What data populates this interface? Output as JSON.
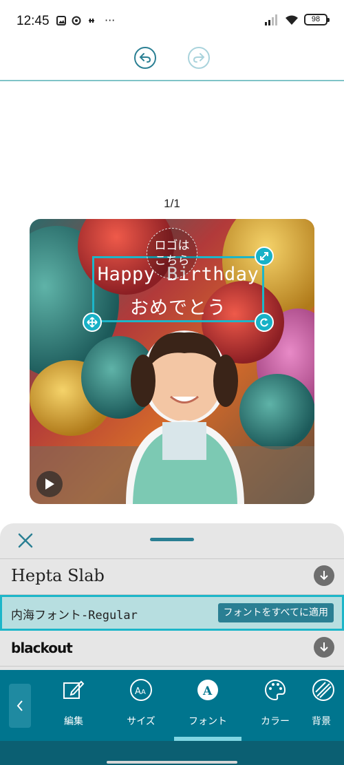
{
  "status_bar": {
    "time": "12:45",
    "more": "···",
    "battery": "98"
  },
  "toolbar": {
    "undo_icon": "undo-icon",
    "redo_icon": "redo-icon"
  },
  "page_indicator": "1/1",
  "canvas": {
    "text_line1": "Happy Birthday",
    "text_line2": "おめでとう",
    "logo_placeholder_line1": "ロゴは",
    "logo_placeholder_line2": "こちら"
  },
  "font_panel": {
    "fonts": [
      {
        "name": "Hepta Slab",
        "downloadable": true
      },
      {
        "name": "内海フォント-Regular",
        "selected": true
      },
      {
        "name": "blackout",
        "downloadable": true
      }
    ],
    "apply_all_label": "フォントをすべてに適用"
  },
  "bottom_nav": {
    "items": [
      {
        "label": "編集",
        "icon": "edit-icon"
      },
      {
        "label": "サイズ",
        "icon": "font-size-icon"
      },
      {
        "label": "フォント",
        "icon": "font-icon",
        "active": true
      },
      {
        "label": "カラー",
        "icon": "palette-icon"
      },
      {
        "label": "背景",
        "icon": "background-icon"
      }
    ]
  },
  "colors": {
    "accent": "#00758e",
    "highlight": "#1cb6c9"
  }
}
